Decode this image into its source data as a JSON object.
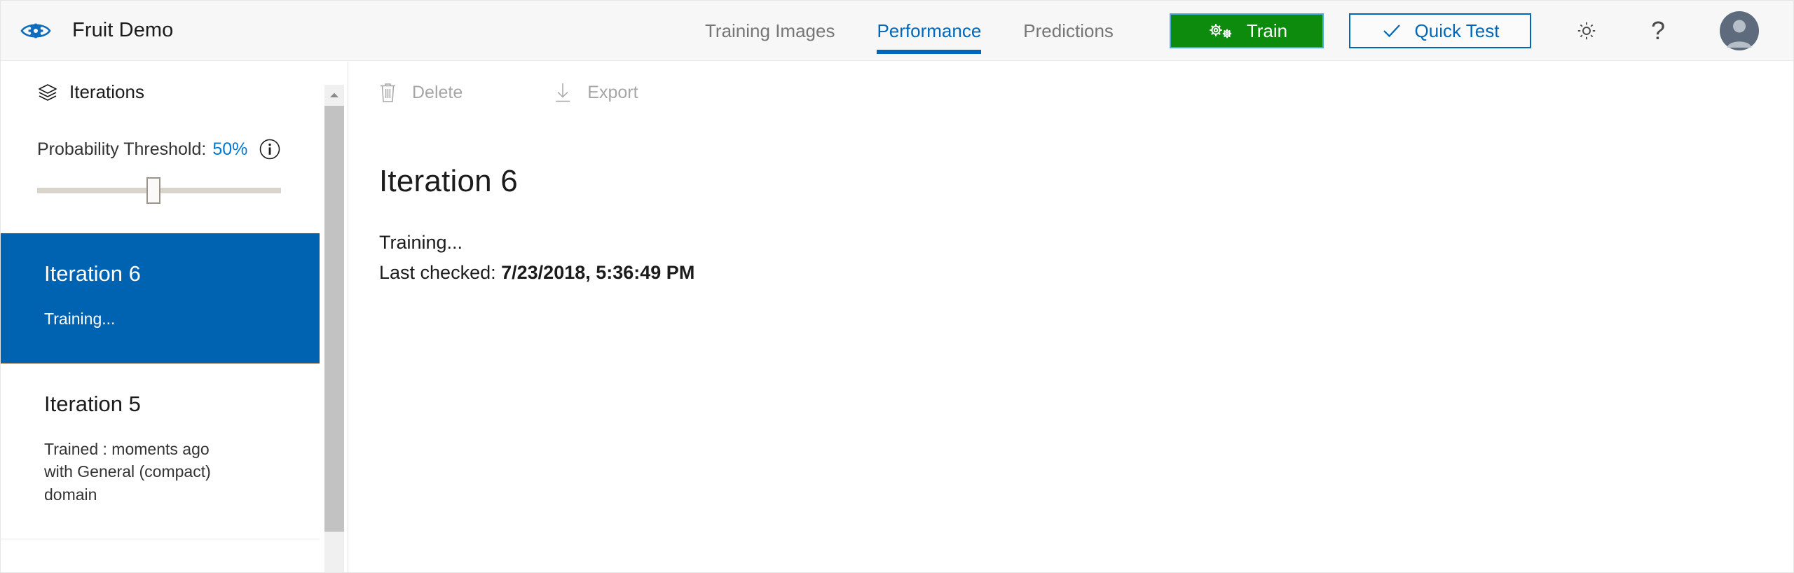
{
  "header": {
    "logo_icon": "custom-vision-eye-gear-icon",
    "app_title": "Fruit Demo",
    "tabs": [
      {
        "label": "Training Images",
        "active": false
      },
      {
        "label": "Performance",
        "active": true
      },
      {
        "label": "Predictions",
        "active": false
      }
    ],
    "train_button": {
      "label": "Train",
      "icon": "gears-icon",
      "bg_color": "#0c8b0c",
      "text_color": "#ffffff"
    },
    "quick_test_button": {
      "label": "Quick Test",
      "icon": "check-icon",
      "border_color": "#0067b8",
      "text_color": "#0067b8"
    },
    "settings_icon": "gear-icon",
    "help_icon": "question-mark-icon",
    "avatar_icon": "user-avatar-icon",
    "accent_color": "#0067b8"
  },
  "sidebar": {
    "section_icon": "layers-icon",
    "section_title": "Iterations",
    "threshold": {
      "label": "Probability Threshold:",
      "value": "50%",
      "value_color": "#0078d4",
      "info_icon": "info-icon",
      "slider_percent": 47
    },
    "iterations": [
      {
        "title": "Iteration 6",
        "status": "Training...",
        "selected": true
      },
      {
        "title": "Iteration 5",
        "status": "Trained : moments ago with General (compact) domain",
        "selected": false
      }
    ],
    "scrollbar": {
      "up_arrow_icon": "chevron-up-icon",
      "thumb_color": "#c2c2c2"
    },
    "selected_bg_color": "#0063b1"
  },
  "main": {
    "toolbar": {
      "delete": {
        "label": "Delete",
        "icon": "trash-icon",
        "disabled": true
      },
      "export": {
        "label": "Export",
        "icon": "download-icon",
        "disabled": true
      }
    },
    "title": "Iteration 6",
    "status": "Training...",
    "last_checked_label": "Last checked:",
    "last_checked_value": "7/23/2018, 5:36:49 PM"
  }
}
